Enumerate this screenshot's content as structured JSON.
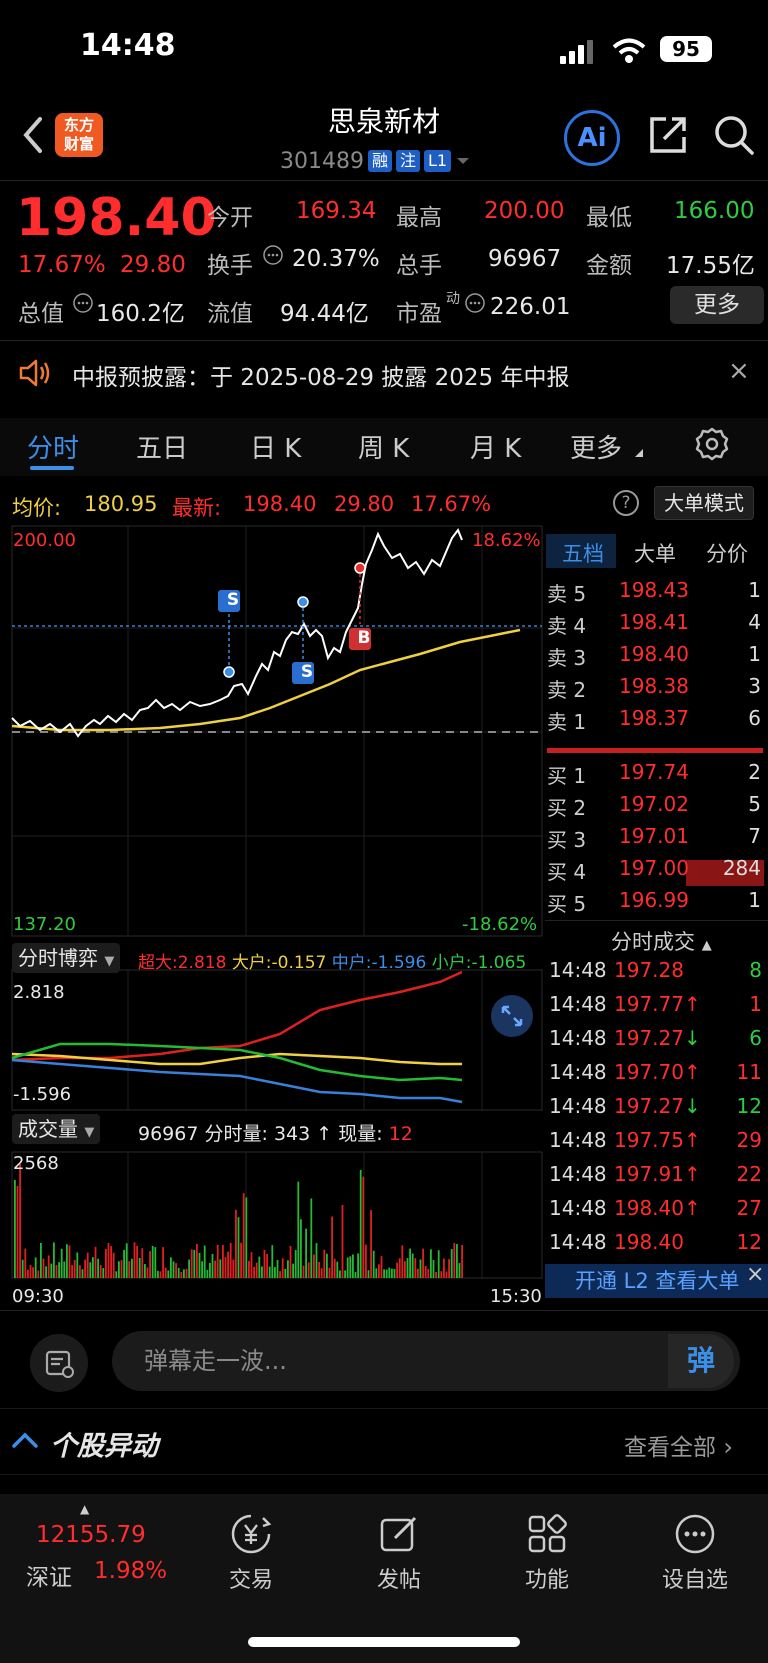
{
  "status_bar": {
    "time": "14:48",
    "battery": "95"
  },
  "header": {
    "title": "思泉新材",
    "code": "301489",
    "tags": [
      "融",
      "注",
      "L1"
    ],
    "ai_label": "Ai",
    "logo_text_line1": "东方",
    "logo_text_line2": "财富"
  },
  "quote": {
    "price": "198.40",
    "change_pct": "17.67%",
    "change": "29.80",
    "open_label": "今开",
    "open": "169.34",
    "high_label": "最高",
    "high": "200.00",
    "low_label": "最低",
    "low": "166.00",
    "turnover_label": "换手",
    "turnover": "20.37%",
    "volume_label": "总手",
    "volume": "96967",
    "amount_label": "金额",
    "amount": "17.55亿",
    "mktcap_label": "总值",
    "mktcap": "160.2亿",
    "float_label": "流值",
    "float": "94.44亿",
    "pe_label": "市盈",
    "pe_sup": "动",
    "pe": "226.01",
    "more_button": "更多"
  },
  "notice": {
    "text": "中报预披露：于 2025-08-29 披露 2025 年中报",
    "close": "×"
  },
  "tabs": [
    {
      "label": "分时",
      "active": true
    },
    {
      "label": "五日"
    },
    {
      "label": "日 K"
    },
    {
      "label": "周 K"
    },
    {
      "label": "月 K"
    },
    {
      "label": "更多"
    }
  ],
  "info_line": {
    "avg_label": "均价:",
    "avg": "180.95",
    "latest_label": "最新:",
    "latest": "198.40",
    "change": "29.80",
    "change_pct": "17.67%",
    "help": "?",
    "bigorder_button": "大单模式"
  },
  "price_chart": {
    "y_top": "200.00",
    "y_top_pct": "18.62%",
    "y_bottom": "137.20",
    "y_bottom_pct": "-18.62%",
    "trade_markers": [
      "S",
      "S",
      "B"
    ]
  },
  "game_panel": {
    "selector": "分时博弈",
    "super_label": "超大:",
    "super": "2.818",
    "large_label": "大户:",
    "large": "-0.157",
    "mid_label": "中户:",
    "mid": "-1.596",
    "small_label": "小户:",
    "small": "-1.065",
    "y_top": "2.818",
    "y_bottom": "-1.596"
  },
  "volume_panel": {
    "selector": "成交量",
    "total": "96967",
    "minute_label": "分时量:",
    "minute": "343",
    "current_label": "现量:",
    "current": "12",
    "y_top": "2568",
    "x_start": "09:30",
    "x_end": "15:30"
  },
  "order_book": {
    "tabs": [
      "五档",
      "大单",
      "分价"
    ],
    "asks": [
      {
        "label": "卖 5",
        "price": "198.43",
        "qty": "1"
      },
      {
        "label": "卖 4",
        "price": "198.41",
        "qty": "4"
      },
      {
        "label": "卖 3",
        "price": "198.40",
        "qty": "1"
      },
      {
        "label": "卖 2",
        "price": "198.38",
        "qty": "3"
      },
      {
        "label": "卖 1",
        "price": "198.37",
        "qty": "6"
      }
    ],
    "bids": [
      {
        "label": "买 1",
        "price": "197.74",
        "qty": "2"
      },
      {
        "label": "买 2",
        "price": "197.02",
        "qty": "5"
      },
      {
        "label": "买 3",
        "price": "197.01",
        "qty": "7"
      },
      {
        "label": "买 4",
        "price": "197.00",
        "qty": "284"
      },
      {
        "label": "买 5",
        "price": "196.99",
        "qty": "1"
      }
    ]
  },
  "ticks": {
    "title": "分时成交",
    "rows": [
      {
        "time": "14:48",
        "price": "197.28",
        "arrow": "",
        "vol": "8",
        "color": "green"
      },
      {
        "time": "14:48",
        "price": "197.77",
        "arrow": "↑",
        "vol": "1",
        "color": "red"
      },
      {
        "time": "14:48",
        "price": "197.27",
        "arrow": "↓",
        "vol": "6",
        "color": "green"
      },
      {
        "time": "14:48",
        "price": "197.70",
        "arrow": "↑",
        "vol": "11",
        "color": "red"
      },
      {
        "time": "14:48",
        "price": "197.27",
        "arrow": "↓",
        "vol": "12",
        "color": "green"
      },
      {
        "time": "14:48",
        "price": "197.75",
        "arrow": "↑",
        "vol": "29",
        "color": "red"
      },
      {
        "time": "14:48",
        "price": "197.91",
        "arrow": "↑",
        "vol": "22",
        "color": "red"
      },
      {
        "time": "14:48",
        "price": "198.40",
        "arrow": "↑",
        "vol": "27",
        "color": "red"
      },
      {
        "time": "14:48",
        "price": "198.40",
        "arrow": "",
        "vol": "12",
        "color": "red"
      }
    ]
  },
  "l2_banner": {
    "text": "开通 L2 查看大单",
    "close": "×"
  },
  "danmaku": {
    "placeholder": "弹幕走一波...",
    "send": "弹"
  },
  "movement": {
    "title": "个股异动",
    "view_all": "查看全部"
  },
  "bottom_nav": {
    "index_value": "12155.79",
    "index_name": "深证",
    "index_change": "1.98%",
    "items": [
      "交易",
      "发帖",
      "功能",
      "设自选"
    ]
  }
}
